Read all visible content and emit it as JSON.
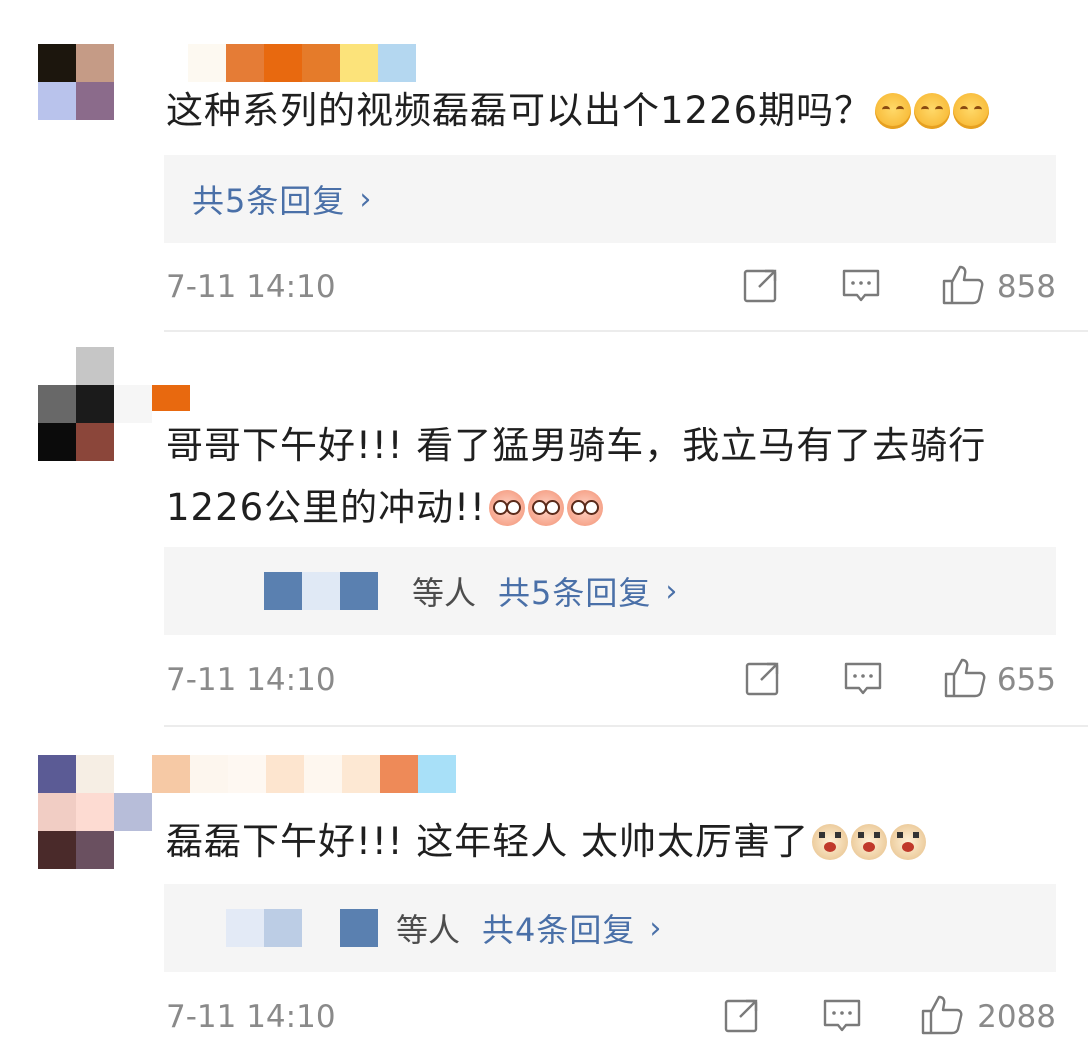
{
  "comments": [
    {
      "text": "这种系列的视频磊磊可以出个1226期吗？",
      "emojis": [
        "smile",
        "smile",
        "smile"
      ],
      "reply": {
        "who": "",
        "label": "共5条回复",
        "chevron": "›"
      },
      "time": "7-11 14:10",
      "likes": "858",
      "icons": [
        "share-icon",
        "comment-icon",
        "like-icon"
      ]
    },
    {
      "text": "哥哥下午好!!! 看了猛男骑车，我立马有了去骑行\n1226公里的冲动!!",
      "emojis": [
        "pink",
        "pink",
        "pink"
      ],
      "reply": {
        "who": "等人",
        "label": "共5条回复",
        "chevron": "›"
      },
      "time": "7-11 14:10",
      "likes": "655",
      "icons": [
        "share-icon",
        "comment-icon",
        "like-icon"
      ]
    },
    {
      "text": "磊磊下午好!!! 这年轻人 太帅太厉害了",
      "emojis": [
        "shock",
        "shock",
        "shock"
      ],
      "reply": {
        "who": "等人",
        "label": "共4条回复",
        "chevron": "›"
      },
      "time": "7-11 14:10",
      "likes": "2088",
      "icons": [
        "share-icon",
        "comment-icon",
        "like-icon"
      ]
    }
  ],
  "colors": {
    "link": "#4a70a8",
    "meta": "#8a8a8a",
    "reply_bg": "#f5f5f5"
  }
}
